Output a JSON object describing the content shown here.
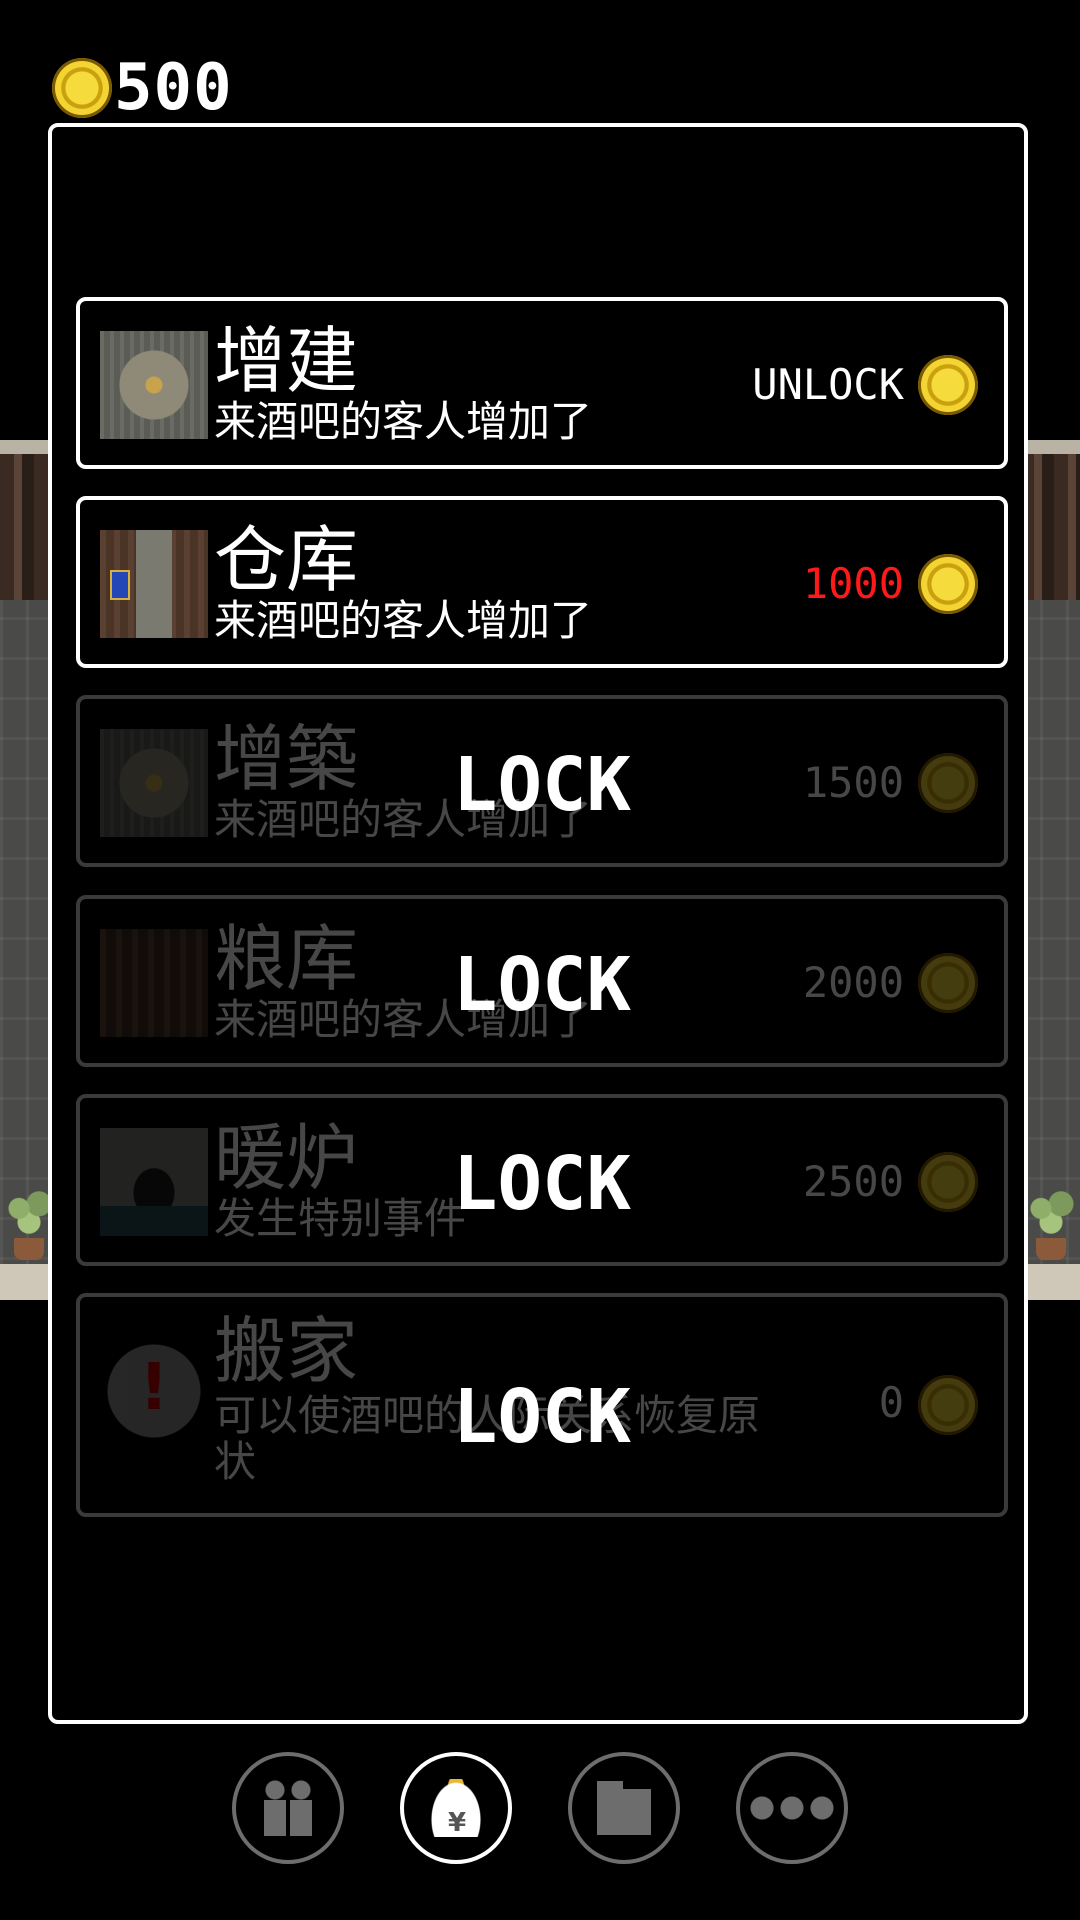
{
  "currency": {
    "icon": "gold-coin-icon",
    "amount": "500"
  },
  "colors": {
    "affordable_price": "#ffffff",
    "unaffordable_price": "#ff1a1a",
    "panel_border": "#ffffff",
    "locked_border": "#3a3a3a"
  },
  "upgrades": [
    {
      "title": "增建",
      "description": "来酒吧的客人增加了",
      "price": "UNLOCK",
      "locked": false,
      "thumbnail": "table-icon"
    },
    {
      "title": "仓库",
      "description": "来酒吧的客人增加了",
      "price": "1000",
      "locked": false,
      "thumbnail": "storage-room-icon"
    },
    {
      "title": "增築",
      "description": "来酒吧的客人增加了",
      "price": "1500",
      "locked": true,
      "lock_label": "LOCK",
      "thumbnail": "table-icon"
    },
    {
      "title": "粮库",
      "description": "来酒吧的客人增加了",
      "price": "2000",
      "locked": true,
      "lock_label": "LOCK",
      "thumbnail": "granary-icon"
    },
    {
      "title": "暖炉",
      "description": "发生特别事件",
      "price": "2500",
      "locked": true,
      "lock_label": "LOCK",
      "thumbnail": "fireplace-icon"
    },
    {
      "title": "搬家",
      "description": "可以使酒吧的人际关系恢复原状",
      "price": "0",
      "locked": true,
      "lock_label": "LOCK",
      "thumbnail": "exclamation-bubble-icon"
    }
  ],
  "nav": [
    {
      "icon": "people-icon",
      "active": false
    },
    {
      "icon": "money-bag-icon",
      "active": true,
      "glyph": "¥"
    },
    {
      "icon": "folder-icon",
      "active": false
    },
    {
      "icon": "more-icon",
      "active": false
    }
  ]
}
